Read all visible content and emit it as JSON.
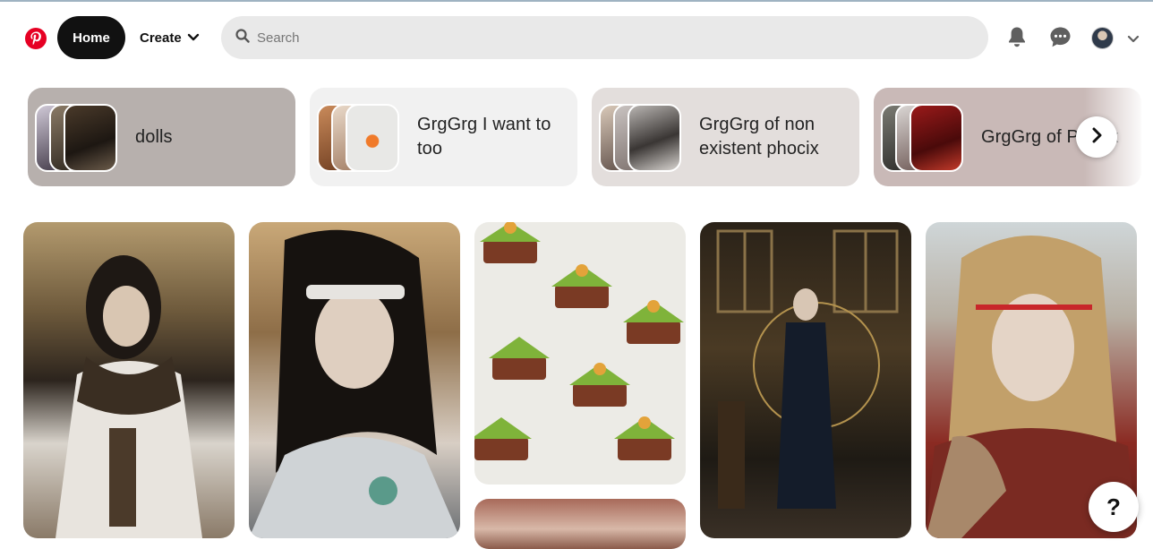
{
  "header": {
    "home_label": "Home",
    "create_label": "Create",
    "search_placeholder": "Search",
    "brand_color": "#e60023"
  },
  "icons": {
    "logo": "pinterest-logo",
    "search": "search-icon",
    "notifications": "bell-icon",
    "messages": "chat-icon",
    "account": "chevron-down-icon",
    "next": "chevron-right-icon"
  },
  "boards": [
    {
      "label": "dolls",
      "color": "#b7b0ad"
    },
    {
      "label": "GrgGrg I want to too",
      "color": "#f1f1f1"
    },
    {
      "label": "GrgGrg of non existent phocix",
      "color": "#e3dedc"
    },
    {
      "label": "GrgGrg of Phœix",
      "color": "#c9b9b7"
    }
  ],
  "help_label": "?"
}
